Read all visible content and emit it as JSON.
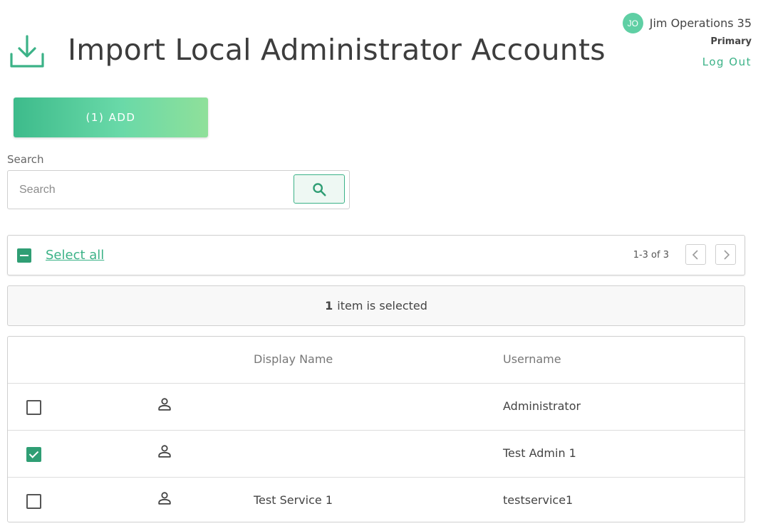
{
  "header": {
    "title": "Import Local Administrator Accounts",
    "icon": "download-icon"
  },
  "user": {
    "initials": "JO",
    "name": "Jim Operations 35",
    "role": "Primary",
    "logout_label": "Log Out"
  },
  "toolbar": {
    "add_label": "(1) ADD"
  },
  "search": {
    "label": "Search",
    "placeholder": "Search",
    "value": ""
  },
  "select_bar": {
    "select_all_label": "Select all",
    "range": "1-3 of 3"
  },
  "selection": {
    "count": "1",
    "text": "item is selected"
  },
  "table": {
    "columns": [
      "Display Name",
      "Username"
    ],
    "rows": [
      {
        "checked": false,
        "display_name": "",
        "username": "Administrator"
      },
      {
        "checked": true,
        "display_name": "",
        "username": "Test Admin 1"
      },
      {
        "checked": false,
        "display_name": "Test Service 1",
        "username": "testservice1"
      }
    ]
  },
  "colors": {
    "accent": "#3bb287",
    "accent_dark": "#2f9e74",
    "avatar": "#5fcfa4"
  }
}
